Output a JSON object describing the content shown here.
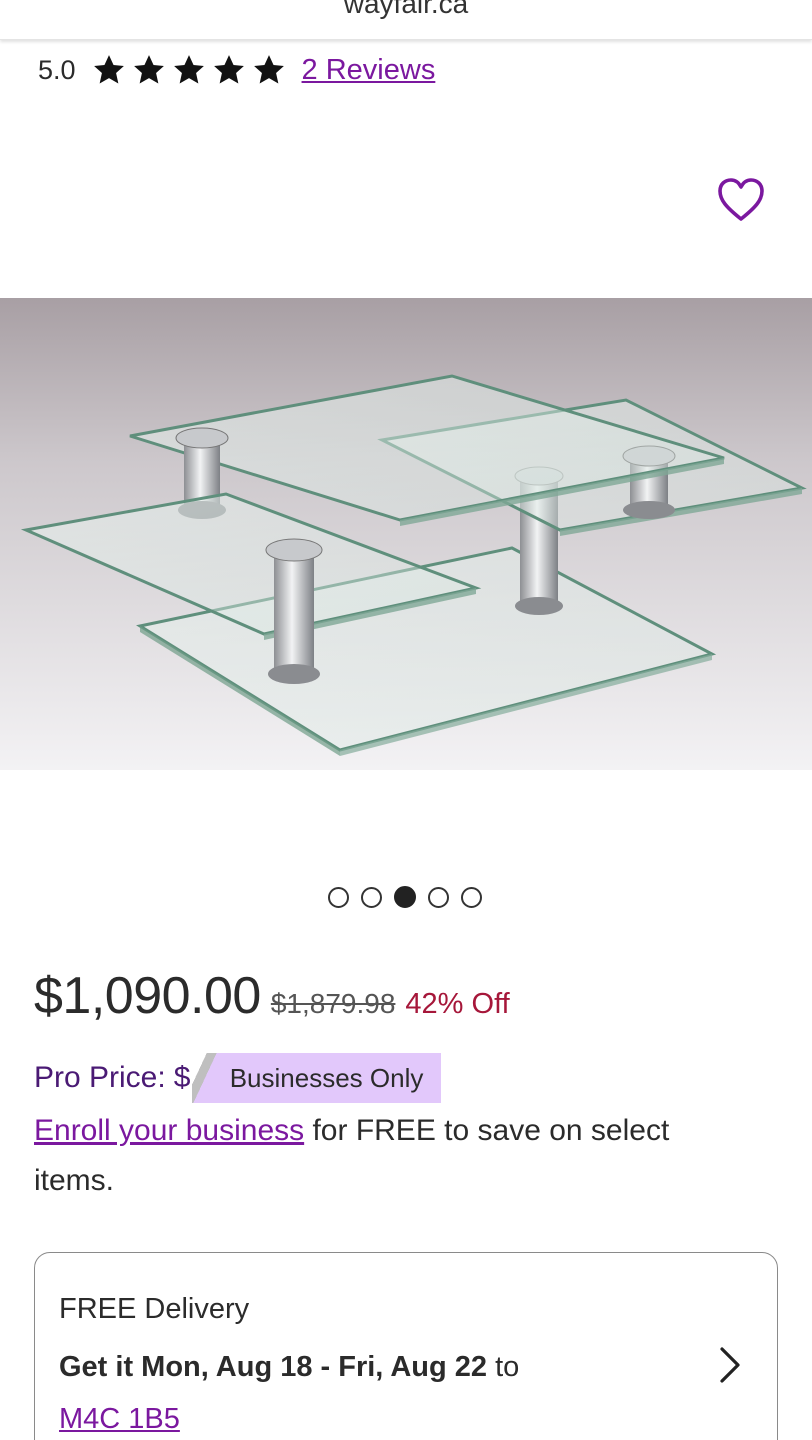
{
  "header": {
    "site": "wayfair.ca"
  },
  "rating": {
    "score": "5.0",
    "stars": 5,
    "reviews_label": "2 Reviews"
  },
  "favorite": {
    "icon": "heart-outline-icon",
    "color": "#7b189f"
  },
  "gallery": {
    "dots": 5,
    "active_index": 2
  },
  "pricing": {
    "price": "$1,090.00",
    "original_price": "$1,879.98",
    "discount": "42% Off",
    "pro_label": "Pro Price:",
    "pro_symbol": "$",
    "pro_badge": "Businesses Only",
    "enroll_link": "Enroll your business",
    "enroll_rest": " for FREE to save on select items."
  },
  "delivery": {
    "title": "FREE Delivery",
    "dates_bold": "Get it Mon, Aug 18 - Fri, Aug 22",
    "to_label": " to",
    "postal_code": "M4C 1B5"
  },
  "colors": {
    "accent": "#7b189f",
    "sale": "#a6173a",
    "badge": "#e2c8fb",
    "pro_text": "#4a1a74"
  }
}
